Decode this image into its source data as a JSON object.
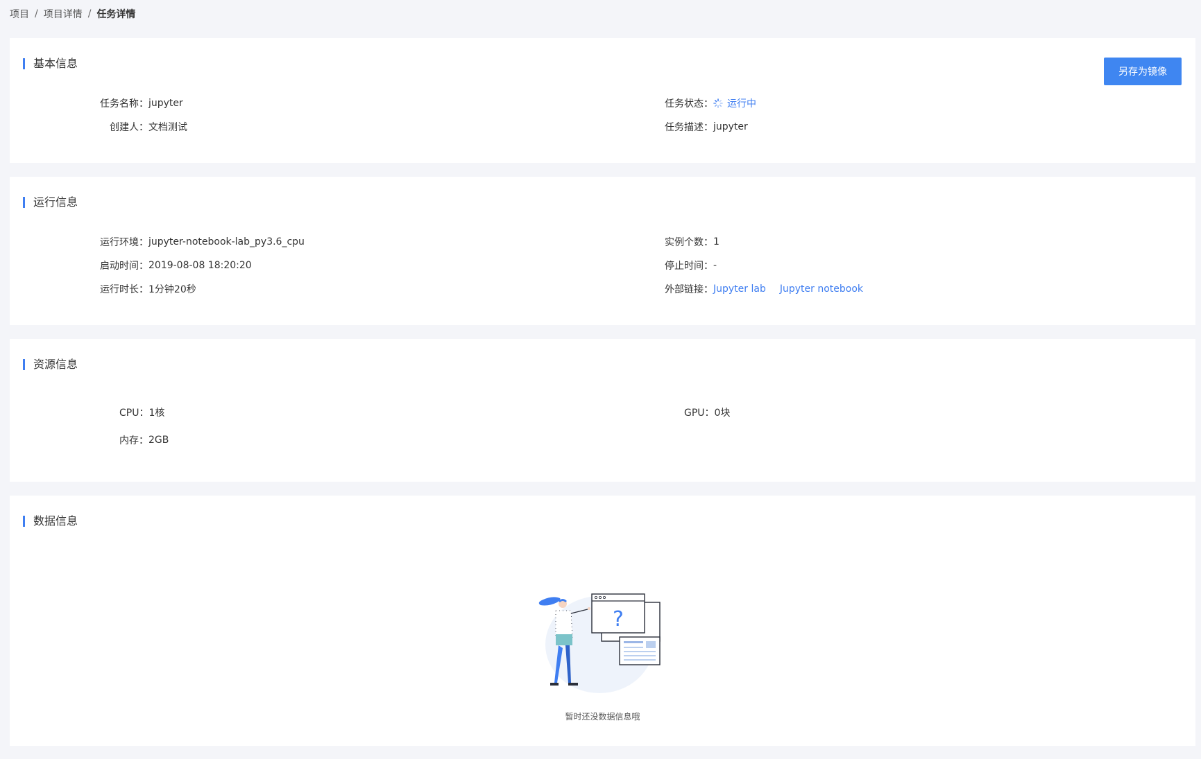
{
  "breadcrumb": {
    "items": [
      "项目",
      "项目详情"
    ],
    "current": "任务详情",
    "separator": "/"
  },
  "basic_info": {
    "title": "基本信息",
    "save_as_image_label": "另存为镜像",
    "task_name_label": "任务名称：",
    "task_name": "jupyter",
    "creator_label": "创建人：",
    "creator": "文档测试",
    "status_label": "任务状态：",
    "status": "运行中",
    "description_label": "任务描述：",
    "description": "jupyter"
  },
  "run_info": {
    "title": "运行信息",
    "env_label": "运行环境：",
    "env": "jupyter-notebook-lab_py3.6_cpu",
    "start_label": "启动时间：",
    "start": "2019-08-08 18:20:20",
    "duration_label": "运行时长：",
    "duration": "1分钟20秒",
    "instances_label": "实例个数：",
    "instances": "1",
    "stop_label": "停止时间：",
    "stop": "-",
    "links_label": "外部链接：",
    "link_lab": "Jupyter lab",
    "link_notebook": "Jupyter notebook"
  },
  "resource_info": {
    "title": "资源信息",
    "cpu_label": "CPU：",
    "cpu": "1核",
    "gpu_label": "GPU：",
    "gpu": "0块",
    "memory_label": "内存：",
    "memory": "2GB"
  },
  "data_info": {
    "title": "数据信息",
    "empty_text": "暂时还没数据信息哦"
  },
  "colors": {
    "accent": "#3f7ef1",
    "button": "#3f86f1",
    "background": "#f4f5f9"
  }
}
